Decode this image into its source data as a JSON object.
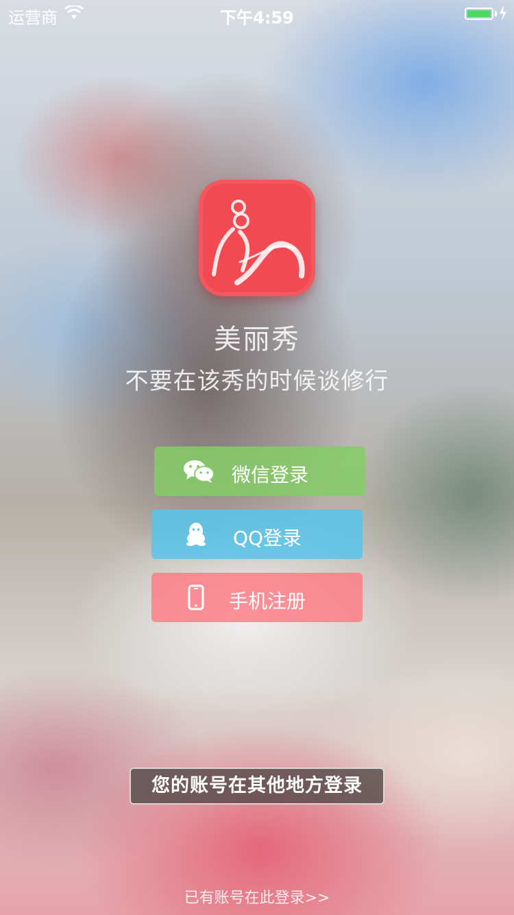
{
  "status_bar": {
    "carrier": "运营商",
    "time": "下午4:59",
    "battery_level": 1.0,
    "colors": {
      "battery_fill": "#4cd964"
    }
  },
  "app": {
    "name": "美丽秀",
    "slogan": "不要在该秀的时候谈修行",
    "icon": "meilixiu-logo-icon",
    "icon_color": "#f24a52"
  },
  "buttons": {
    "wechat": {
      "label": "微信登录",
      "icon": "wechat-icon",
      "color": "#84cc66"
    },
    "qq": {
      "label": "QQ登录",
      "icon": "qq-penguin-icon",
      "color": "#58c4eb"
    },
    "phone": {
      "label": "手机注册",
      "icon": "mobile-phone-icon",
      "color": "#ff7882"
    }
  },
  "toast": {
    "message": "您的账号在其他地方登录"
  },
  "footer": {
    "existing_account_link": "已有账号在此登录>>"
  }
}
